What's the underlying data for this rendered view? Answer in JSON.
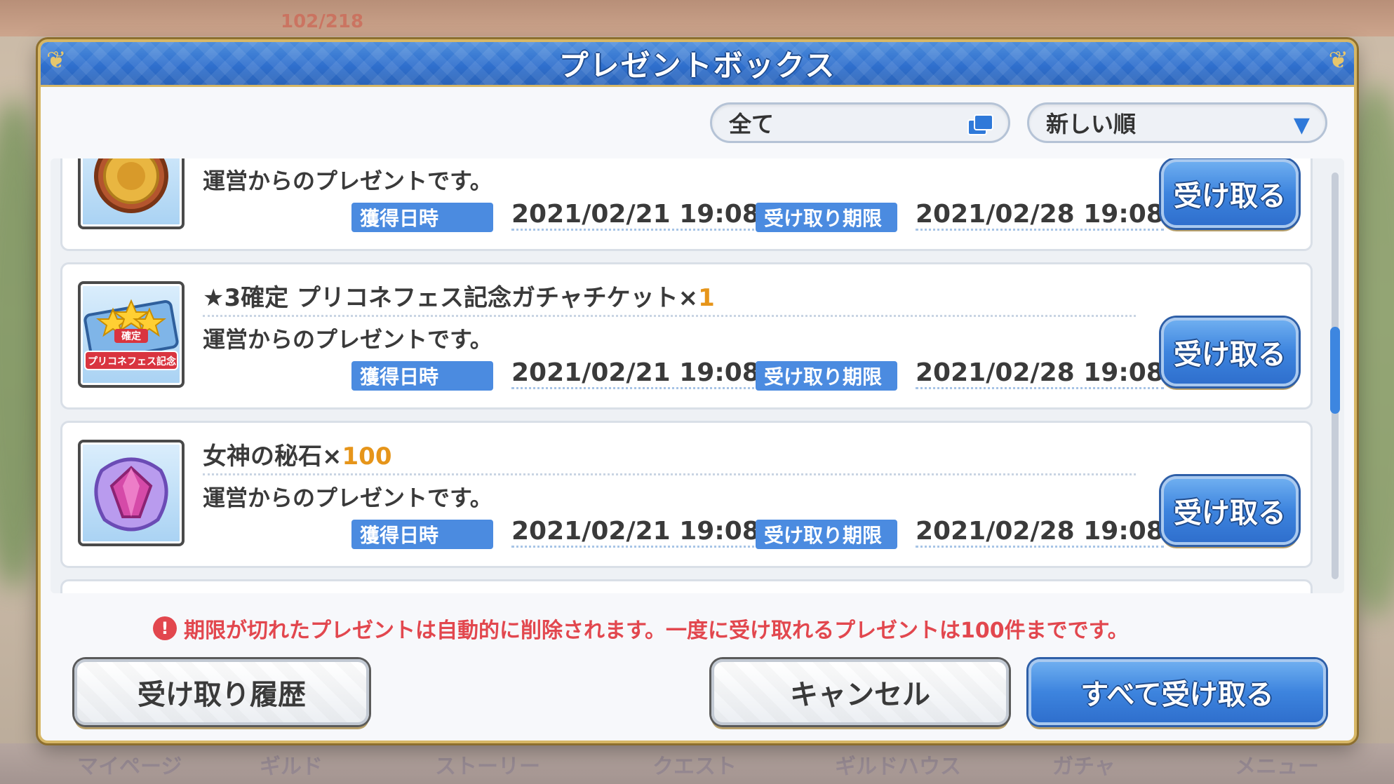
{
  "background": {
    "top_counter": "102/218",
    "nav_items": [
      "マイページ",
      "ギルド",
      "ストーリー",
      "クエスト",
      "ギルドハウス",
      "ガチャ",
      "メニュー"
    ]
  },
  "dialog": {
    "title": "プレゼントボックス",
    "filter": {
      "selected": "全て",
      "icon": "stacked-windows-icon"
    },
    "sort": {
      "selected": "新しい順",
      "icon": "triangle-down-icon"
    },
    "labels": {
      "acquired": "獲得日時",
      "deadline": "受け取り期限",
      "receive": "受け取る"
    },
    "items": [
      {
        "name": "",
        "quantity": "",
        "description": "運営からのプレゼントです。",
        "acquired_at": "2021/02/21 19:08",
        "expires_at": "2021/02/28 19:08",
        "icon": "lion-medal-icon"
      },
      {
        "name": "★3確定 プリコネフェス記念ガチャチケット×",
        "quantity": "1",
        "description": "運営からのプレゼントです。",
        "acquired_at": "2021/02/21 19:08",
        "expires_at": "2021/02/28 19:08",
        "icon": "gacha-ticket-icon",
        "icon_text_top": "確定",
        "icon_text_bottom": "プリコネフェス記念"
      },
      {
        "name": "女神の秘石×",
        "quantity": "100",
        "description": "運営からのプレゼントです。",
        "acquired_at": "2021/02/21 19:08",
        "expires_at": "2021/02/28 19:08",
        "icon": "goddess-stone-icon"
      }
    ],
    "notice": "期限が切れたプレゼントは自動的に削除されます。一度に受け取れるプレゼントは100件までです。",
    "notice_icon": "!",
    "buttons": {
      "history": "受け取り履歴",
      "cancel": "キャンセル",
      "receive_all": "すべて受け取る"
    }
  },
  "colors": {
    "primary_blue": "#3d84de",
    "gold_border": "#d7b766",
    "quantity_orange": "#e6951a",
    "notice_red": "#e2474e"
  }
}
